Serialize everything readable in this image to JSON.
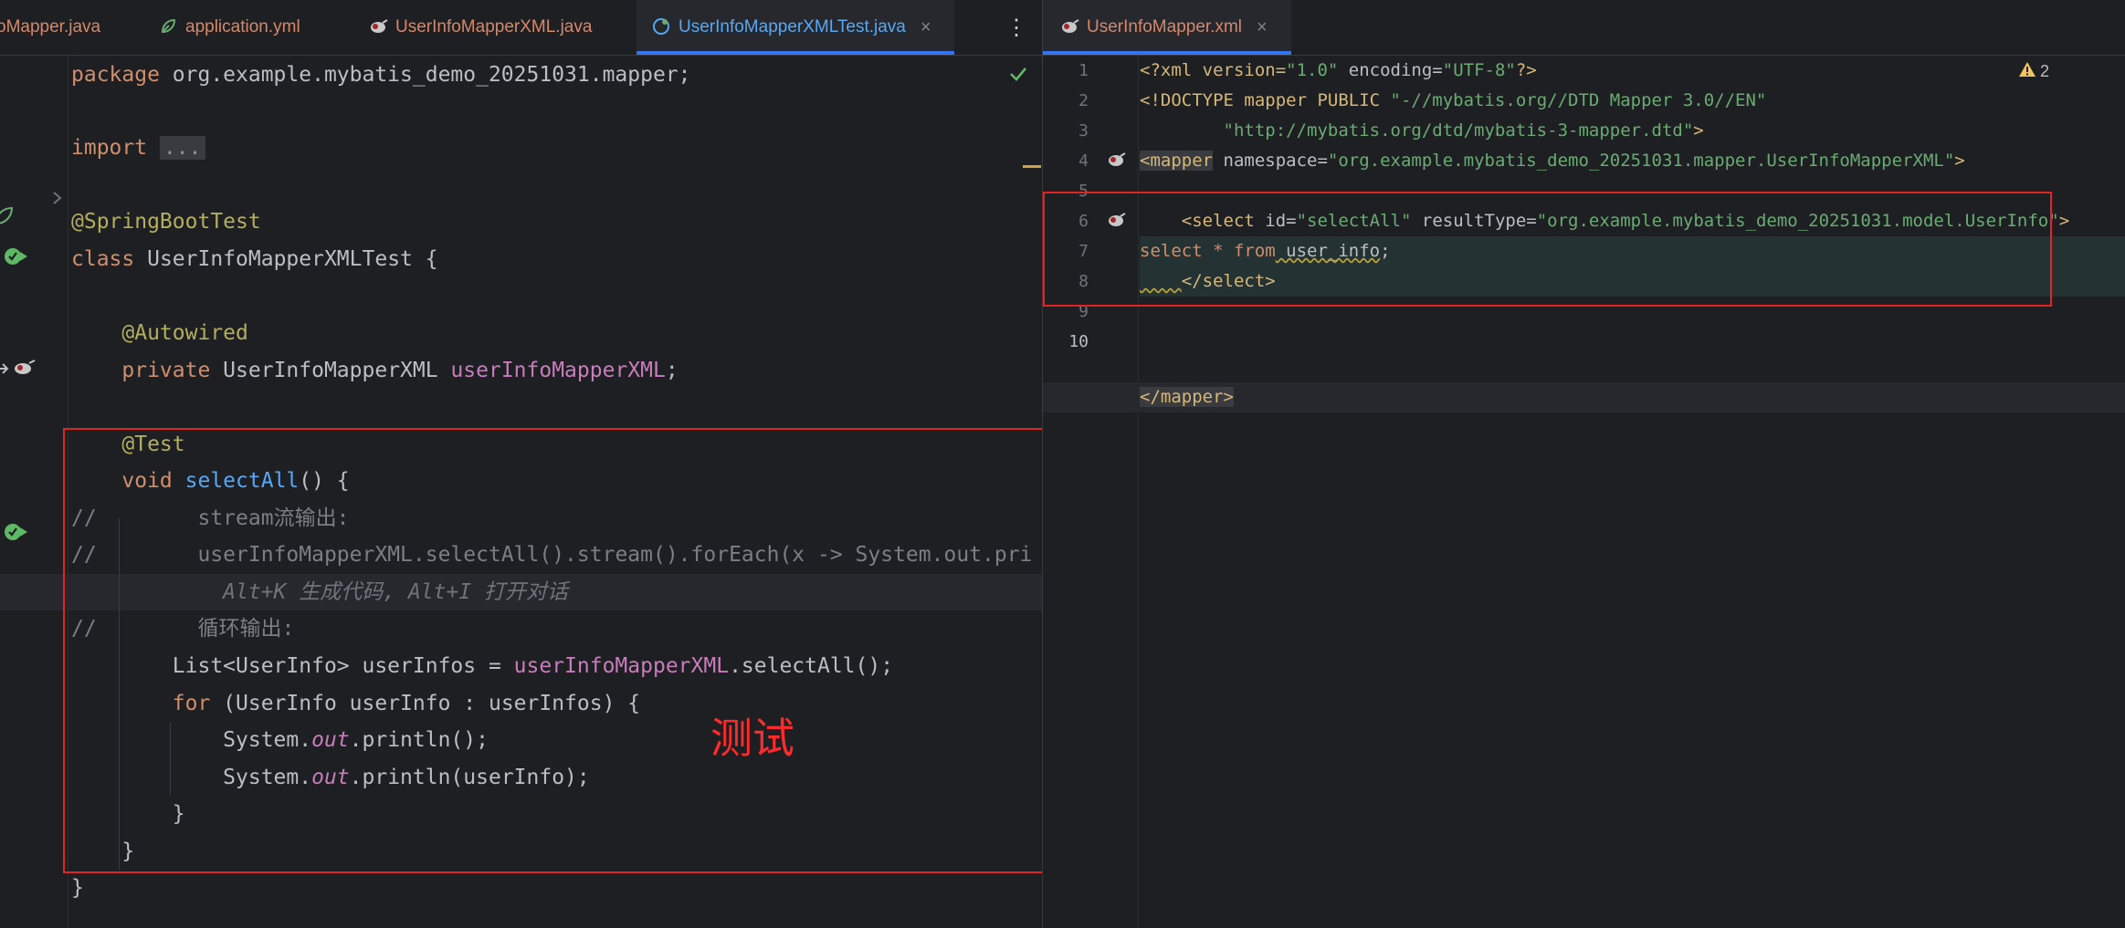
{
  "left_editor": {
    "tabs": [
      {
        "label": "oMapper.java",
        "icon": "java-class-icon"
      },
      {
        "label": "application.yml",
        "icon": "spring-config-icon"
      },
      {
        "label": "UserInfoMapperXML.java",
        "icon": "mybatis-mapper-icon"
      },
      {
        "label": "UserInfoMapperXMLTest.java",
        "icon": "test-class-icon",
        "active": true,
        "close": "×"
      }
    ],
    "more_icon": "⋮",
    "fold_placeholder": "...",
    "comment_prefix": "//",
    "code": {
      "pkg_kw": "package",
      "pkg_name": " org.example.mybatis_demo_20251031.mapper;",
      "import_kw": "import",
      "ann_springboottest": "@SpringBootTest",
      "class_kw": "class",
      "class_name": " UserInfoMapperXMLTest {",
      "ann_autowired": "@Autowired",
      "private_kw": "private",
      "field_type": " UserInfoMapperXML ",
      "field_name": "userInfoMapperXML",
      "semicolon": ";",
      "ann_test": "@Test",
      "void_kw": "void",
      "method_name": "selectAll",
      "method_tail": "() {",
      "comment1": "stream流输出:",
      "comment2": "userInfoMapperXML.selectAll().stream().forEach(x -> System.out.pri",
      "ai_hint": "Alt+K 生成代码, Alt+I 打开对话",
      "comment3": "循环输出:",
      "list_decl": "List<UserInfo> userInfos = ",
      "list_call": ".selectAll();",
      "for_kw": "for",
      "for_tail": " (UserInfo userInfo : userInfos) {",
      "sys": "System.",
      "out": "out",
      "println_empty": ".println();",
      "println_user": ".println(userInfo);",
      "close_brace": "}"
    }
  },
  "right_editor": {
    "tabs": [
      {
        "label": "UserInfoMapper.xml",
        "icon": "mybatis-xml-icon",
        "active": true,
        "close": "×"
      }
    ],
    "warning_count": "2",
    "warning_icon": "warning-triangle-icon",
    "line_numbers": [
      "1",
      "2",
      "3",
      "4",
      "5",
      "6",
      "7",
      "8",
      "9",
      "10"
    ],
    "xml": {
      "l1_a": "<?xml version=",
      "l1_v1": "\"1.0\"",
      "l1_b": " encoding=",
      "l1_v2": "\"UTF-8\"",
      "l1_c": "?>",
      "l2_a": "<!DOCTYPE mapper PUBLIC ",
      "l2_v": "\"-//mybatis.org//DTD Mapper 3.0//EN\"",
      "l3_v": "\"http://mybatis.org/dtd/mybatis-3-mapper.dtd\"",
      "l3_c": ">",
      "l4_tag": "<mapper",
      "l4_attr": " namespace=",
      "l4_v": "\"org.example.mybatis_demo_20251031.mapper.UserInfoMapperXML\"",
      "l4_c": ">",
      "l6_tag": "<select",
      "l6_attr1": " id=",
      "l6_v1": "\"selectAll\"",
      "l6_attr2": " resultType=",
      "l6_v2": "\"org.example.mybatis_demo_20251031.model.UserInfo\"",
      "l6_c": ">",
      "l7_kw1": "select",
      "l7_star": " * ",
      "l7_kw2": "from",
      "l7_tbl": " user_info",
      "l7_semi": ";",
      "l8_tag": "</select>",
      "l10_tag": "</mapper>"
    }
  },
  "annotation": {
    "label": "测试"
  },
  "colors": {
    "background": "#1e1f22",
    "keyword": "#cf8e6d",
    "annotation": "#b3ae60",
    "field": "#c77dbb",
    "method": "#56a8f5",
    "string": "#6aab73",
    "xml_tag": "#d5b778",
    "comment": "#7a7e85",
    "tab_accent": "#3574f0",
    "highlight_box": "#e02424"
  }
}
